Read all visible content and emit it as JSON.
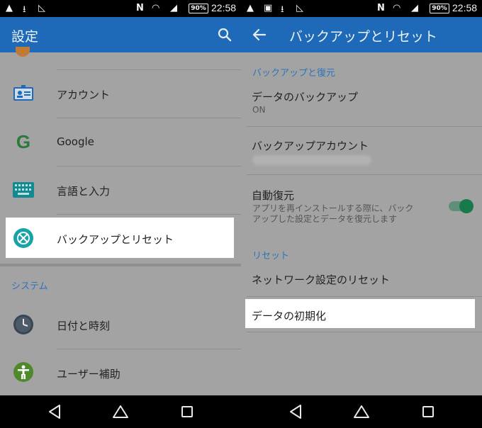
{
  "status_bar": {
    "battery": "90%",
    "time": "22:58"
  },
  "left_screen": {
    "title": "設定",
    "items": [
      {
        "label": "アカウント",
        "icon": "account-card-icon"
      },
      {
        "label": "Google",
        "icon": "google-g-icon"
      },
      {
        "label": "言語と入力",
        "icon": "keyboard-icon"
      },
      {
        "label": "バックアップとリセット",
        "icon": "backup-reset-icon"
      }
    ],
    "section_system": "システム",
    "system_items": [
      {
        "label": "日付と時刻",
        "icon": "clock-icon"
      },
      {
        "label": "ユーザー補助",
        "icon": "accessibility-icon"
      }
    ]
  },
  "right_screen": {
    "title": "バックアップとリセット",
    "section_backup": "バックアップと復元",
    "data_backup": {
      "title": "データのバックアップ",
      "value": "ON"
    },
    "backup_account": {
      "title": "バックアップアカウント"
    },
    "auto_restore": {
      "title": "自動復元",
      "desc_line1": "アプリを再インストールする際に、バック",
      "desc_line2": "アップした設定とデータを復元します",
      "enabled": true
    },
    "section_reset": "リセット",
    "network_reset": "ネットワーク設定のリセット",
    "factory_reset": "データの初期化"
  },
  "colors": {
    "accent": "#1e6ab8",
    "section": "#2c74bd",
    "toggle": "#167a4a",
    "dim_bg": "#a3a3a3"
  }
}
